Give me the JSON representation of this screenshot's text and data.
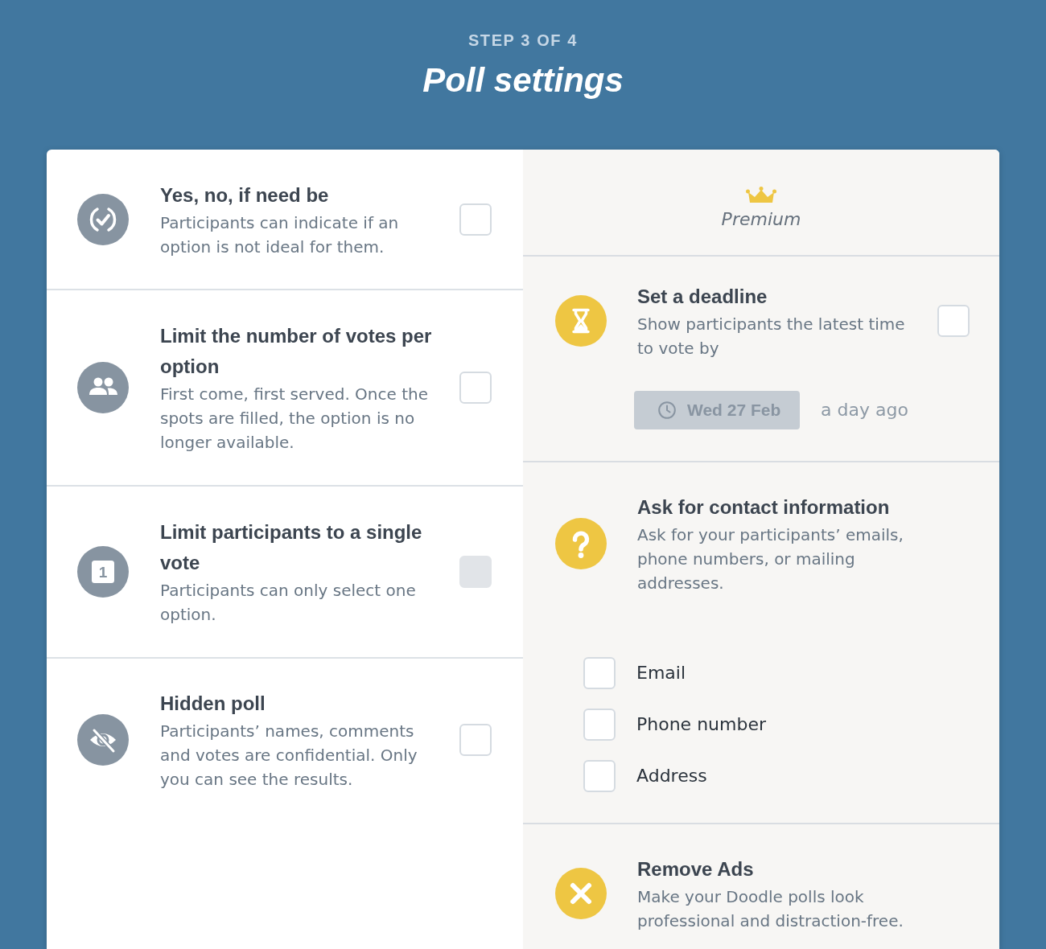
{
  "header": {
    "step": "STEP 3 OF 4",
    "title": "Poll settings"
  },
  "basic_settings": [
    {
      "kind": "ifneedbe",
      "title": "Yes, no, if need be",
      "description": "Participants can indicate if an option is not ideal for them.",
      "checked": false,
      "disabled": false
    },
    {
      "kind": "limit",
      "title": "Limit the number of votes per option",
      "description": "First come, first served. Once the spots are filled, the option is no longer available.",
      "checked": false,
      "disabled": false
    },
    {
      "kind": "single",
      "icon_label": "1",
      "title": "Limit participants to a single vote",
      "description": "Participants can only select one option.",
      "checked": false,
      "disabled": true
    },
    {
      "kind": "hidden",
      "title": "Hidden poll",
      "description": "Participants’ names, comments and votes are confidential. Only you can see the results.",
      "checked": false,
      "disabled": false
    }
  ],
  "premium": {
    "label": "Premium",
    "settings": [
      {
        "kind": "deadline",
        "title": "Set a deadline",
        "description": "Show participants the latest time to vote by",
        "checked": false,
        "date_button": {
          "label": "Wed 27 Feb",
          "disabled": true
        },
        "relative_time": "a day ago"
      },
      {
        "kind": "contact",
        "title": "Ask for contact information",
        "description": "Ask for your participants’ emails, phone numbers, or mailing addresses.",
        "options": [
          {
            "label": "Email",
            "checked": false
          },
          {
            "label": "Phone number",
            "checked": false
          },
          {
            "label": "Address",
            "checked": false
          }
        ]
      },
      {
        "kind": "ads",
        "title": "Remove Ads",
        "description": "Make your Doodle polls look professional and distraction-free."
      }
    ]
  }
}
